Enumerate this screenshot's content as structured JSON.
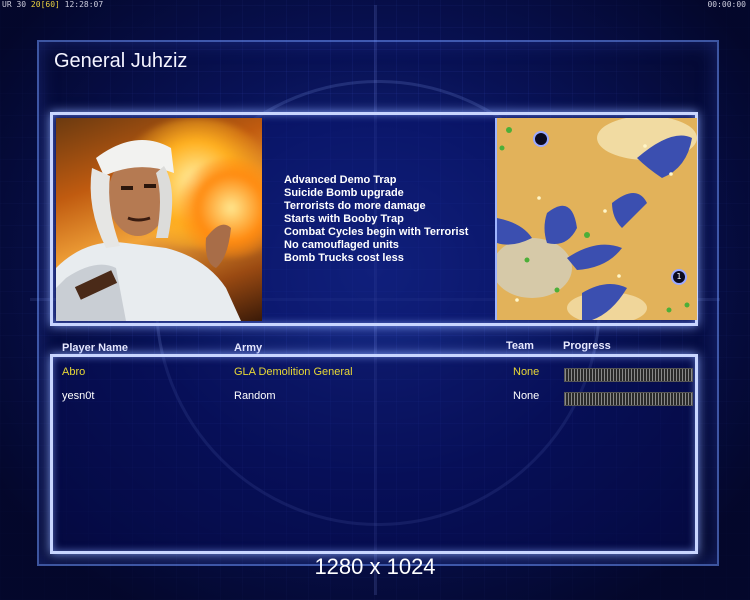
{
  "status": {
    "left_prefix": "UR 30",
    "left_fps": "20",
    "left_fps_avg": "[60]",
    "left_time": "12:28:07",
    "right_time": "00:00:00"
  },
  "general_title": "General Juhziz",
  "perks": [
    "Advanced Demo Trap",
    "Suicide Bomb upgrade",
    "Terrorists do more damage",
    "Starts with Booby Trap",
    "Combat Cycles begin with Terrorist",
    "No camouflaged units",
    "Bomb Trucks cost less"
  ],
  "minimap": {
    "start_1": "1",
    "start_2": ""
  },
  "players_table": {
    "headers": {
      "name": "Player Name",
      "army": "Army",
      "team": "Team",
      "progress": "Progress"
    },
    "rows": [
      {
        "name": "Abro",
        "army": "GLA Demolition General",
        "team": "None",
        "color": "#e8d836"
      },
      {
        "name": "yesn0t",
        "army": "Random",
        "team": "None",
        "color": "#ffffff"
      }
    ]
  },
  "resolution_label": "1280 x 1024"
}
